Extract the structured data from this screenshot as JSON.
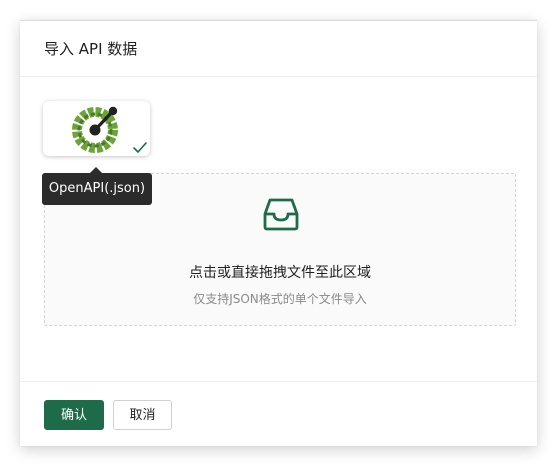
{
  "dialog": {
    "title": "导入 API 数据"
  },
  "formats": [
    {
      "name": "OpenAPI(.json)",
      "selected": true,
      "icon": "openapi-logo-icon"
    }
  ],
  "tooltip": {
    "text": "OpenAPI(.json)"
  },
  "dropzone": {
    "icon": "inbox-icon",
    "title": "点击或直接拖拽文件至此区域",
    "hint": "仅支持JSON格式的单个文件导入"
  },
  "footer": {
    "confirm_label": "确认",
    "cancel_label": "取消"
  },
  "colors": {
    "primary": "#1e6b4a",
    "openapi_green": "#6ba539",
    "tooltip_bg": "#2b2b2b"
  }
}
